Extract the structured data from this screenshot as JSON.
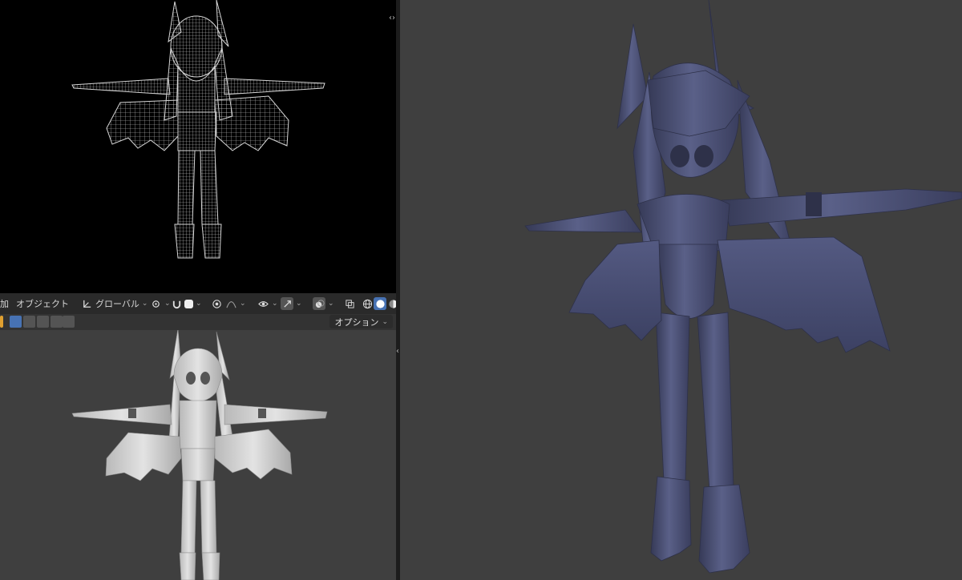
{
  "header": {
    "add_label": "加",
    "object_menu": "オブジェクト",
    "transform_orientation": "グローバル",
    "options_label": "オプション"
  },
  "icons": {
    "orientation": "axis-orientation-icon",
    "pivot": "pivot-point-icon",
    "snap": "snap-magnet-icon",
    "snap_target": "snap-target-icon",
    "proportional": "proportional-edit-icon",
    "falloff": "falloff-curve-icon",
    "visibility": "eye-visibility-icon",
    "gizmo": "gizmo-icon",
    "overlay": "overlay-icon",
    "xray": "xray-icon",
    "shading_wire": "wireframe-shading-icon",
    "shading_solid": "solid-shading-icon",
    "shading_material": "material-shading-icon"
  },
  "colors": {
    "viewport_bg": "#3f3f3f",
    "wire_bg": "#000000",
    "wire_line": "#cfcfcf",
    "solid_model": "#c9c9c9",
    "render_model": "#4a4f73",
    "active_blue": "#4772b3"
  }
}
